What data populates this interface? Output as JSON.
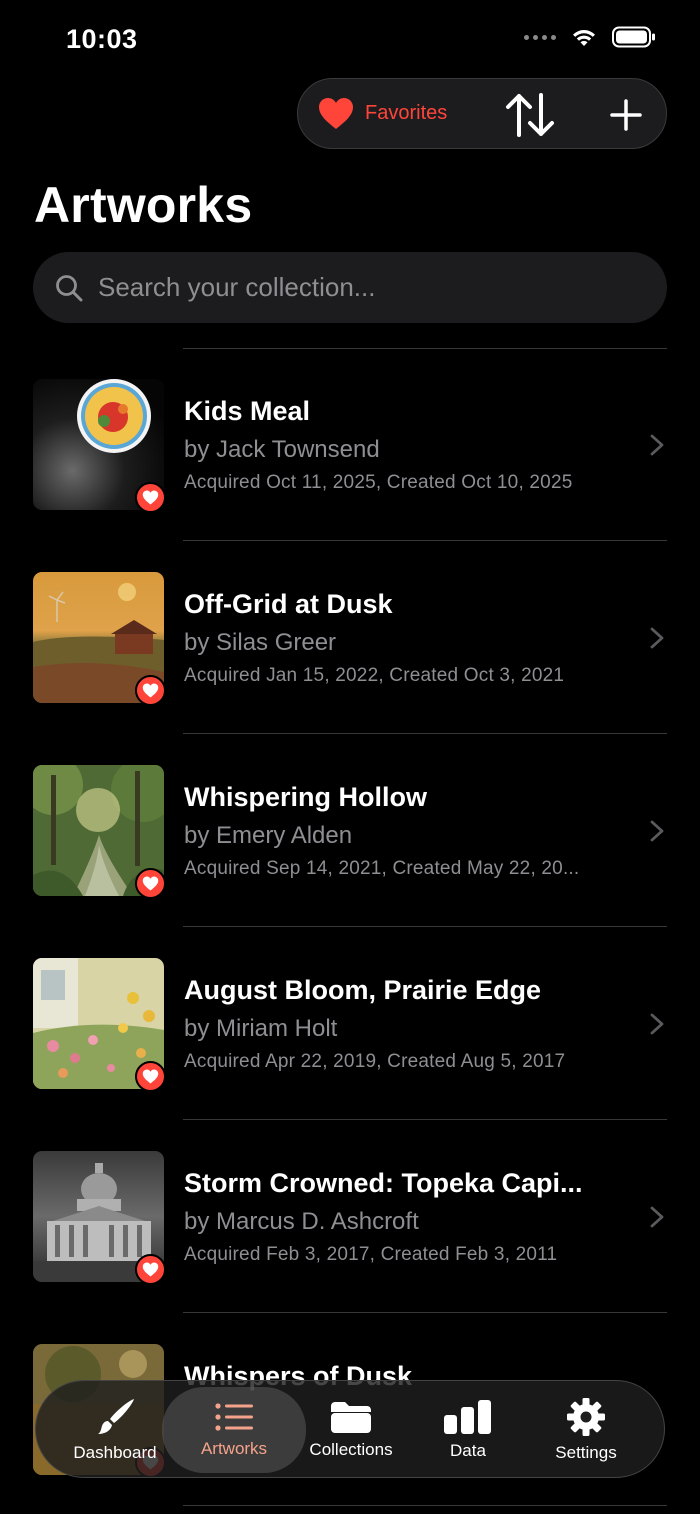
{
  "status_bar": {
    "time": "10:03"
  },
  "toolbar": {
    "favorites_label": "Favorites"
  },
  "page": {
    "title": "Artworks"
  },
  "search": {
    "placeholder": "Search your collection..."
  },
  "artworks": [
    {
      "title": "Kids Meal",
      "artist": "by Jack Townsend",
      "dates": "Acquired Oct 11, 2025, Created Oct 10, 2025",
      "favorite": true
    },
    {
      "title": "Off-Grid at Dusk",
      "artist": "by Silas Greer",
      "dates": "Acquired Jan 15, 2022, Created Oct 3, 2021",
      "favorite": true
    },
    {
      "title": "Whispering Hollow",
      "artist": "by Emery Alden",
      "dates": "Acquired Sep 14, 2021, Created May 22, 20...",
      "favorite": true
    },
    {
      "title": "August Bloom, Prairie Edge",
      "artist": "by Miriam Holt",
      "dates": "Acquired Apr 22, 2019, Created Aug 5, 2017",
      "favorite": true
    },
    {
      "title": "Storm Crowned: Topeka Capi...",
      "artist": "by Marcus D. Ashcroft",
      "dates": "Acquired Feb 3, 2017, Created Feb 3, 2011",
      "favorite": true
    },
    {
      "title": "Whispers of Dusk",
      "artist": "",
      "dates": "",
      "favorite": true
    }
  ],
  "tabs": [
    {
      "label": "Dashboard",
      "icon": "paintbrush-icon",
      "active": false
    },
    {
      "label": "Artworks",
      "icon": "list-icon",
      "active": true
    },
    {
      "label": "Collections",
      "icon": "folder-icon",
      "active": false
    },
    {
      "label": "Data",
      "icon": "bar-chart-icon",
      "active": false
    },
    {
      "label": "Settings",
      "icon": "gear-icon",
      "active": false
    }
  ],
  "colors": {
    "accent_red": "#ff453a",
    "active_tab": "#f4a38a",
    "secondary_text": "#8e8e93"
  }
}
